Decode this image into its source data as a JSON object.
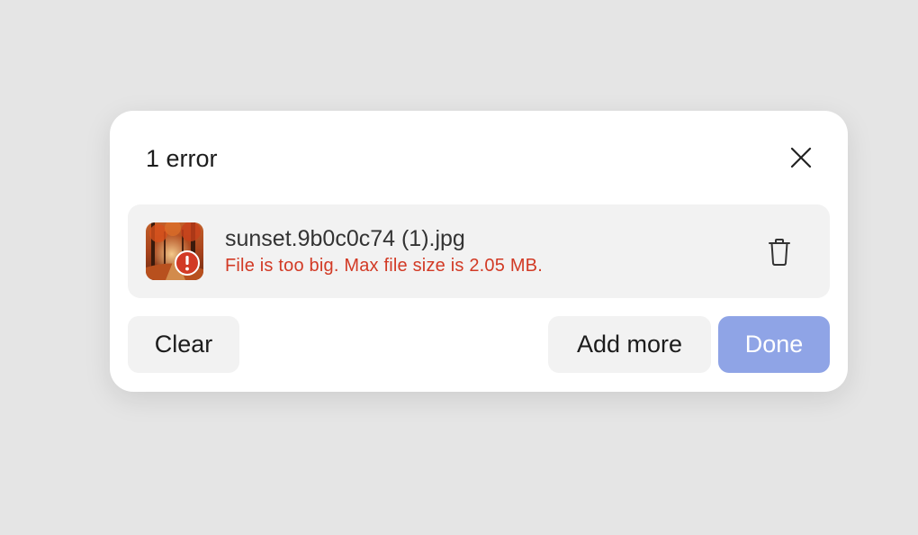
{
  "dialog": {
    "title": "1 error",
    "close_icon": "close-icon"
  },
  "file": {
    "name": "sunset.9b0c0c74 (1).jpg",
    "error": "File is too big. Max file size is 2.05 MB.",
    "thumbnail_icon": "image-thumbnail",
    "status_icon": "error-icon",
    "delete_icon": "trash-icon"
  },
  "actions": {
    "clear_label": "Clear",
    "add_more_label": "Add more",
    "done_label": "Done"
  },
  "colors": {
    "error": "#d23a25",
    "primary_disabled": "#8fa4e6",
    "surface": "#f2f2f2",
    "backdrop": "#e5e5e5"
  }
}
